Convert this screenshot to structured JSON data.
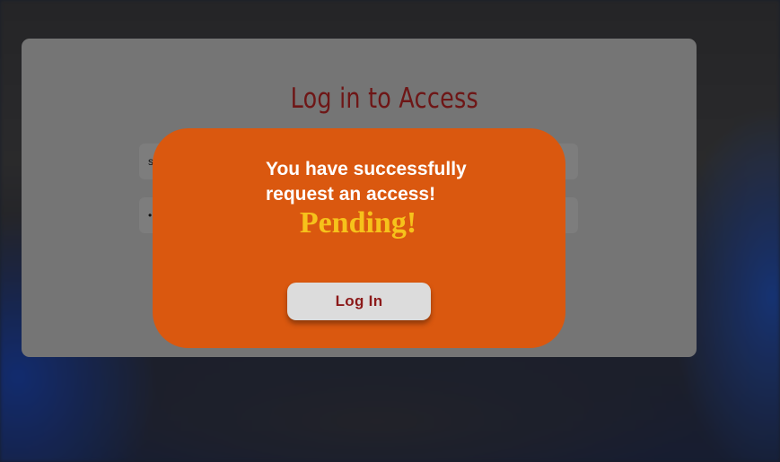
{
  "login_form": {
    "title": "Log in to Access",
    "username_value": "s",
    "password_value": "•"
  },
  "modal": {
    "message": "You have successfully request an access!",
    "status": "Pending!",
    "button_label": "Log In"
  },
  "colors": {
    "modal_background": "#da580f",
    "status_text": "#f6c21b",
    "button_text": "#8c1a1a",
    "title_text": "#6e1616"
  }
}
